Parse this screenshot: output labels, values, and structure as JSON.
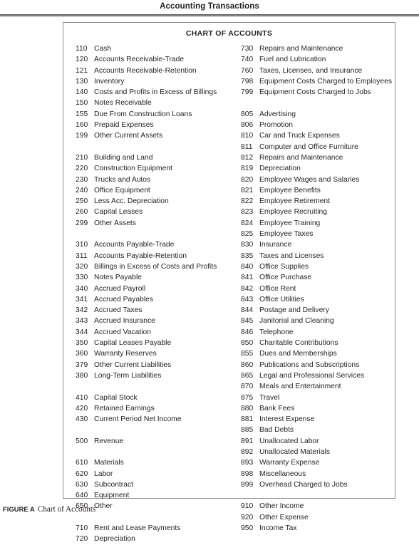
{
  "page": {
    "running_head": "Accounting Transactions"
  },
  "figure": {
    "box_title": "CHART OF ACCOUNTS",
    "caption_tag": "FIGURE A",
    "caption_text": "Chart of Accounts",
    "left_column": [
      {
        "number": "110",
        "label": "Cash"
      },
      {
        "number": "120",
        "label": "Accounts Receivable-Trade"
      },
      {
        "number": "121",
        "label": "Accounts Receivable-Retention"
      },
      {
        "number": "130",
        "label": "Inventory"
      },
      {
        "number": "140",
        "label": "Costs and Profits in Excess of Billings"
      },
      {
        "number": "150",
        "label": "Notes Receivable"
      },
      {
        "number": "155",
        "label": "Due From Construction Loans"
      },
      {
        "number": "160",
        "label": "Prepaid Expenses"
      },
      {
        "number": "199",
        "label": "Other Current Assets"
      },
      {
        "number": "",
        "label": ""
      },
      {
        "number": "210",
        "label": "Building and Land"
      },
      {
        "number": "220",
        "label": "Construction Equipment"
      },
      {
        "number": "230",
        "label": "Trucks and Autos"
      },
      {
        "number": "240",
        "label": "Office Equipment"
      },
      {
        "number": "250",
        "label": "Less Acc. Depreciation"
      },
      {
        "number": "260",
        "label": "Capital Leases"
      },
      {
        "number": "299",
        "label": "Other Assets"
      },
      {
        "number": "",
        "label": ""
      },
      {
        "number": "310",
        "label": "Accounts Payable-Trade"
      },
      {
        "number": "311",
        "label": "Accounts Payable-Retention"
      },
      {
        "number": "320",
        "label": "Billings in Excess of Costs and Profits"
      },
      {
        "number": "330",
        "label": "Notes Payable"
      },
      {
        "number": "340",
        "label": "Accrued Payroll"
      },
      {
        "number": "341",
        "label": "Accrued Payables"
      },
      {
        "number": "342",
        "label": "Accrued Taxes"
      },
      {
        "number": "343",
        "label": "Accrued Insurance"
      },
      {
        "number": "344",
        "label": "Accrued Vacation"
      },
      {
        "number": "350",
        "label": "Capital Leases Payable"
      },
      {
        "number": "360",
        "label": "Warranty Reserves"
      },
      {
        "number": "379",
        "label": "Other Current Liabilities"
      },
      {
        "number": "380",
        "label": "Long-Term Liabilities"
      },
      {
        "number": "",
        "label": ""
      },
      {
        "number": "410",
        "label": "Capital Stock"
      },
      {
        "number": "420",
        "label": "Retained Earnings"
      },
      {
        "number": "430",
        "label": "Current Period Net Income"
      },
      {
        "number": "",
        "label": ""
      },
      {
        "number": "500",
        "label": "Revenue"
      },
      {
        "number": "",
        "label": ""
      },
      {
        "number": "610",
        "label": "Materials"
      },
      {
        "number": "620",
        "label": "Labor"
      },
      {
        "number": "630",
        "label": "Subcontract"
      },
      {
        "number": "640",
        "label": "Equipment"
      },
      {
        "number": "650",
        "label": "Other"
      },
      {
        "number": "",
        "label": ""
      },
      {
        "number": "710",
        "label": "Rent and Lease Payments"
      },
      {
        "number": "720",
        "label": "Depreciation"
      }
    ],
    "right_column": [
      {
        "number": "730",
        "label": "Repairs and Maintenance"
      },
      {
        "number": "740",
        "label": "Fuel and Lubrication"
      },
      {
        "number": "760",
        "label": "Taxes, Licenses, and Insurance"
      },
      {
        "number": "798",
        "label": "Equipment Costs Charged to Employees"
      },
      {
        "number": "799",
        "label": "Equipment Costs Charged to Jobs"
      },
      {
        "number": "",
        "label": ""
      },
      {
        "number": "805",
        "label": "Advertising"
      },
      {
        "number": "806",
        "label": "Promotion"
      },
      {
        "number": "810",
        "label": "Car and Truck Expenses"
      },
      {
        "number": "811",
        "label": "Computer and Office Furniture"
      },
      {
        "number": "812",
        "label": "Repairs and Maintenance"
      },
      {
        "number": "819",
        "label": "Depreciation"
      },
      {
        "number": "820",
        "label": "Employee Wages and Salaries"
      },
      {
        "number": "821",
        "label": "Employee Benefits"
      },
      {
        "number": "822",
        "label": "Employee Retirement"
      },
      {
        "number": "823",
        "label": "Employee Recruiting"
      },
      {
        "number": "824",
        "label": "Employee Training"
      },
      {
        "number": "825",
        "label": "Employee Taxes"
      },
      {
        "number": "830",
        "label": "Insurance"
      },
      {
        "number": "835",
        "label": "Taxes and Licenses"
      },
      {
        "number": "840",
        "label": "Office Supplies"
      },
      {
        "number": "841",
        "label": "Office Purchase"
      },
      {
        "number": "842",
        "label": "Office Rent"
      },
      {
        "number": "843",
        "label": "Office Utilities"
      },
      {
        "number": "844",
        "label": "Postage and Delivery"
      },
      {
        "number": "845",
        "label": "Janitorial and Cleaning"
      },
      {
        "number": "846",
        "label": "Telephone"
      },
      {
        "number": "850",
        "label": "Charitable Contributions"
      },
      {
        "number": "855",
        "label": "Dues and Memberships"
      },
      {
        "number": "860",
        "label": "Publications and Subscriptions"
      },
      {
        "number": "865",
        "label": "Legal and Professional Services"
      },
      {
        "number": "870",
        "label": "Meals and Entertainment"
      },
      {
        "number": "875",
        "label": "Travel"
      },
      {
        "number": "880",
        "label": "Bank Fees"
      },
      {
        "number": "881",
        "label": "Interest Expense"
      },
      {
        "number": "885",
        "label": "Bad Debts"
      },
      {
        "number": "891",
        "label": "Unallocated Labor"
      },
      {
        "number": "892",
        "label": "Unallocated Materials"
      },
      {
        "number": "893",
        "label": "Warranty Expense"
      },
      {
        "number": "898",
        "label": "Miscellaneous"
      },
      {
        "number": "899",
        "label": "Overhead Charged to Jobs"
      },
      {
        "number": "",
        "label": ""
      },
      {
        "number": "910",
        "label": "Other Income"
      },
      {
        "number": "920",
        "label": "Other Expense"
      },
      {
        "number": "950",
        "label": "Income Tax"
      }
    ]
  }
}
